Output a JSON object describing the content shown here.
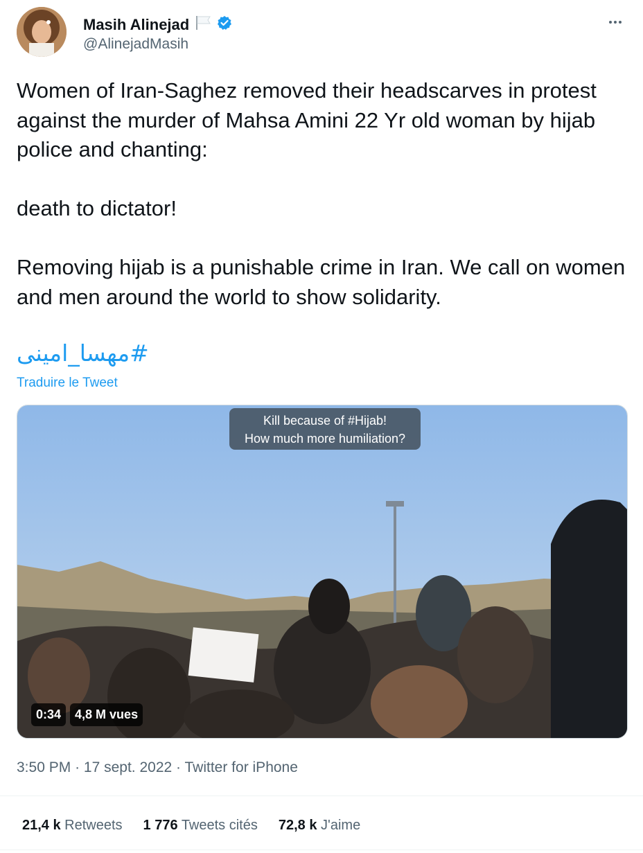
{
  "author": {
    "display_name": "Masih Alinejad",
    "handle": "@AlinejadMasih"
  },
  "tweet": {
    "paragraphs": [
      "Women of Iran-Saghez removed their headscarves in protest against the murder of Mahsa Amini 22 Yr old woman by hijab police and chanting:",
      "death to dictator!",
      "Removing hijab is a punishable crime in Iran. We call on women and men around the world to show solidarity."
    ],
    "hashtag": "#مهسا_امینی",
    "translate_label": "Traduire le Tweet"
  },
  "media": {
    "caption_line1": "Kill because of #Hijab!",
    "caption_line2": "How much more humiliation?",
    "duration": "0:34",
    "views": "4,8 M vues"
  },
  "meta": {
    "time": "3:50 PM",
    "date": "17 sept. 2022",
    "source": "Twitter for iPhone",
    "separator": "·"
  },
  "stats": {
    "retweets_count": "21,4 k",
    "retweets_label": "Retweets",
    "quotes_count": "1 776",
    "quotes_label": "Tweets cités",
    "likes_count": "72,8 k",
    "likes_label": "J'aime"
  },
  "colors": {
    "accent": "#1d9bf0",
    "text": "#0f1419",
    "muted": "#536471"
  },
  "icons": [
    "flag-icon",
    "verified-icon",
    "more-icon"
  ]
}
